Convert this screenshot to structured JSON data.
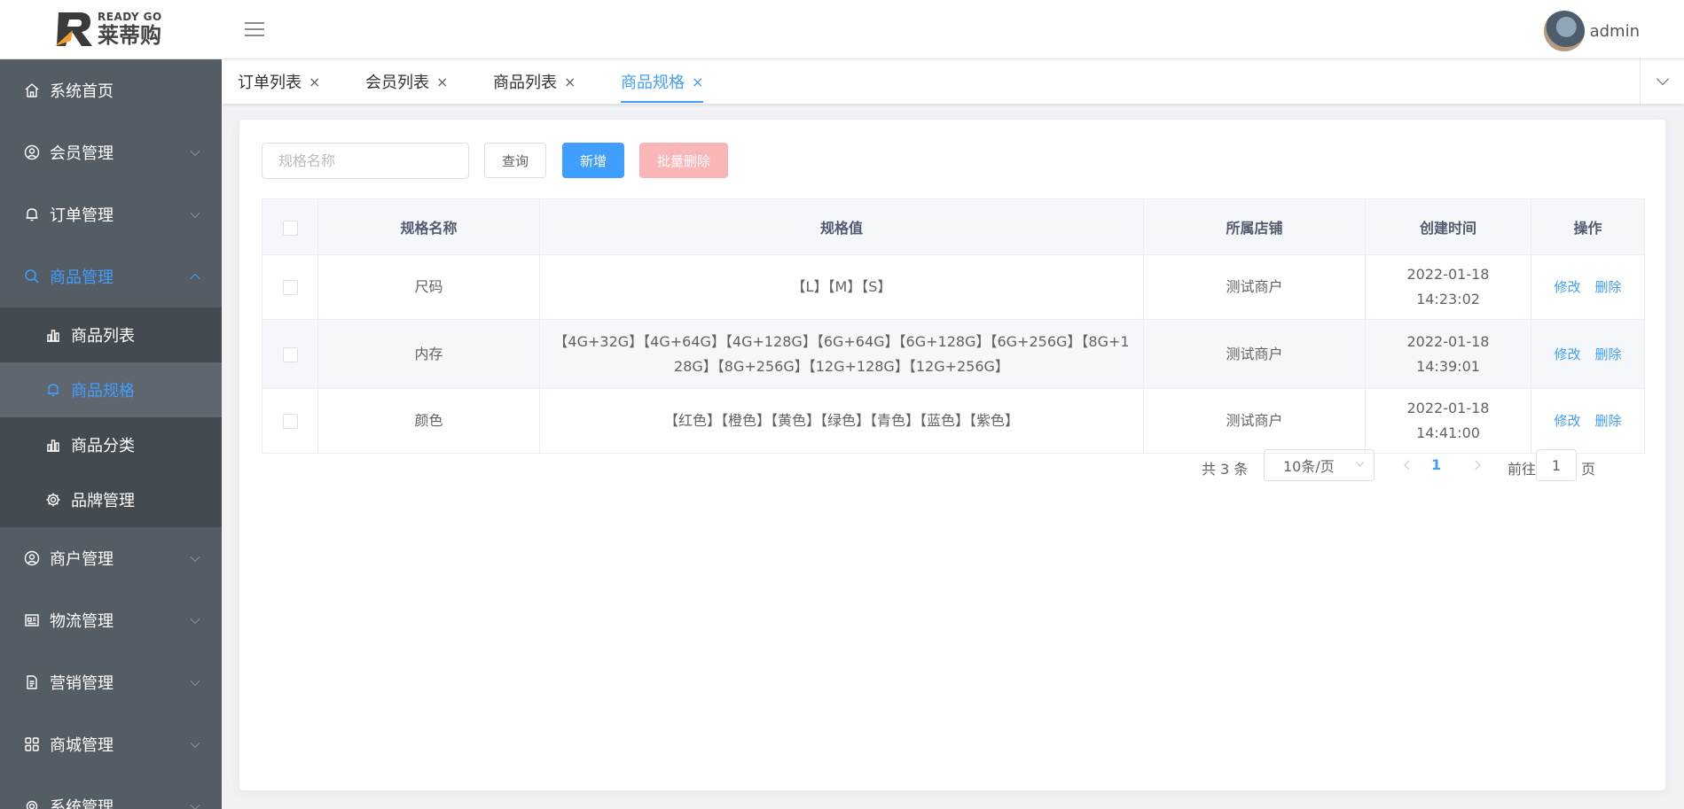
{
  "brand": {
    "en": "READY GO",
    "cn": "莱蒂购"
  },
  "header": {
    "username": "admin"
  },
  "sidebar": {
    "items": [
      {
        "label": "系统首页"
      },
      {
        "label": "会员管理"
      },
      {
        "label": "订单管理"
      },
      {
        "label": "商品管理"
      },
      {
        "label": "商户管理"
      },
      {
        "label": "物流管理"
      },
      {
        "label": "营销管理"
      },
      {
        "label": "商城管理"
      },
      {
        "label": "系统管理"
      }
    ],
    "sub_items": [
      {
        "label": "商品列表"
      },
      {
        "label": "商品规格"
      },
      {
        "label": "商品分类"
      },
      {
        "label": "品牌管理"
      }
    ]
  },
  "tabs": [
    {
      "label": "订单列表",
      "close": "×"
    },
    {
      "label": "会员列表",
      "close": "×"
    },
    {
      "label": "商品列表",
      "close": "×"
    },
    {
      "label": "商品规格",
      "close": "×"
    }
  ],
  "toolbar": {
    "search_placeholder": "规格名称",
    "query_label": "查询",
    "add_label": "新增",
    "batch_delete_label": "批量删除"
  },
  "table": {
    "headers": [
      "规格名称",
      "规格值",
      "所属店铺",
      "创建时间",
      "操作"
    ],
    "rows": [
      {
        "name": "尺码",
        "values": "【L】【M】【S】",
        "shop": "测试商户",
        "created": "2022-01-18 14:23:02",
        "edit": "修改",
        "delete": "删除"
      },
      {
        "name": "内存",
        "values": "【4G+32G】【4G+64G】【4G+128G】【6G+64G】【6G+128G】【6G+256G】【8G+128G】【8G+256G】【12G+128G】【12G+256G】",
        "shop": "测试商户",
        "created": "2022-01-18 14:39:01",
        "edit": "修改",
        "delete": "删除"
      },
      {
        "name": "颜色",
        "values": "【红色】【橙色】【黄色】【绿色】【青色】【蓝色】【紫色】",
        "shop": "测试商户",
        "created": "2022-01-18 14:41:00",
        "edit": "修改",
        "delete": "删除"
      }
    ]
  },
  "pagination": {
    "total": "共 3 条",
    "page_size": "10条/页",
    "current_page": "1",
    "goto_prefix": "前往",
    "goto_value": "1",
    "goto_suffix": "页"
  },
  "colors": {
    "accent": "#409eff",
    "sidebar_bg": "#545c64",
    "submenu_bg": "#434a50",
    "danger_light": "#fab6b6"
  }
}
